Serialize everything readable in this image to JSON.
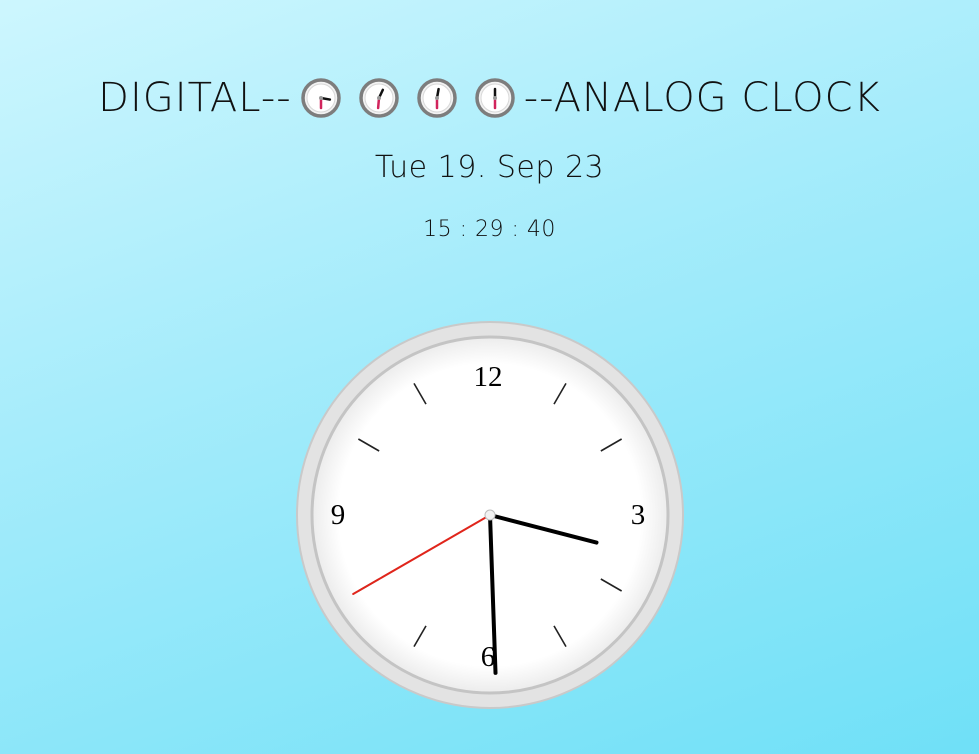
{
  "header": {
    "title_left": "DIGITAL--",
    "title_right": "--ANALOG CLOCK",
    "mini_clocks": [
      {
        "icon": "clock-icon",
        "hour_hand_deg": 100,
        "minute_hand_deg": 180
      },
      {
        "icon": "clock-icon",
        "hour_hand_deg": 25,
        "minute_hand_deg": 185
      },
      {
        "icon": "clock-icon",
        "hour_hand_deg": 10,
        "minute_hand_deg": 180
      },
      {
        "icon": "clock-icon",
        "hour_hand_deg": 0,
        "minute_hand_deg": 180
      }
    ]
  },
  "date": "Tue 19. Sep 23",
  "time": "15 : 29 : 40",
  "analog_clock": {
    "numerals": {
      "twelve": "12",
      "three": "3",
      "six": "6",
      "nine": "9"
    },
    "hours": 15,
    "minutes": 29,
    "seconds": 40,
    "colors": {
      "second_hand": "#e0251b",
      "hour_minute_hands": "#000000",
      "face": "#ffffff",
      "rim": "#dcdcdc"
    }
  }
}
